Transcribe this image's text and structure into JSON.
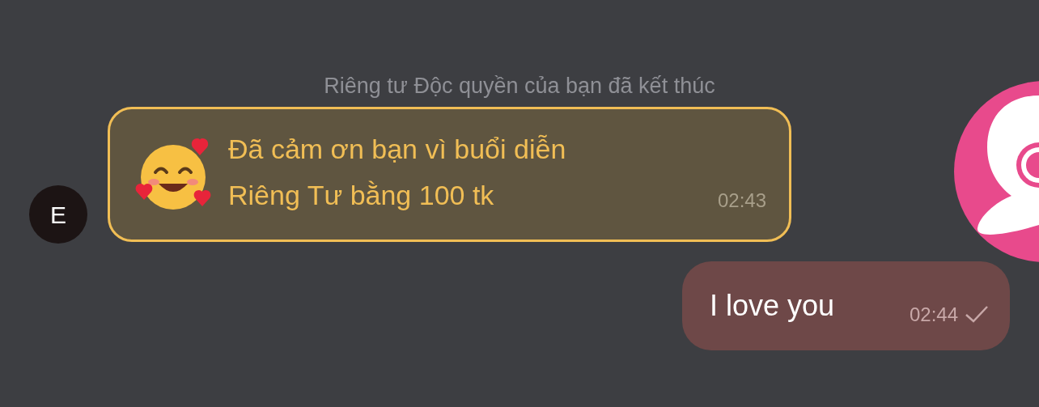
{
  "system_notice": "Riêng tư Độc quyền của bạn đã kết thúc",
  "messages": [
    {
      "kind": "tip",
      "sender_initial": "E",
      "lines": [
        "Đã cảm ơn bạn vì buổi diễn",
        "Riêng Tư bằng 100 tk"
      ],
      "time": "02:43"
    },
    {
      "kind": "outgoing",
      "text": "I love you",
      "time": "02:44",
      "read": true
    }
  ]
}
